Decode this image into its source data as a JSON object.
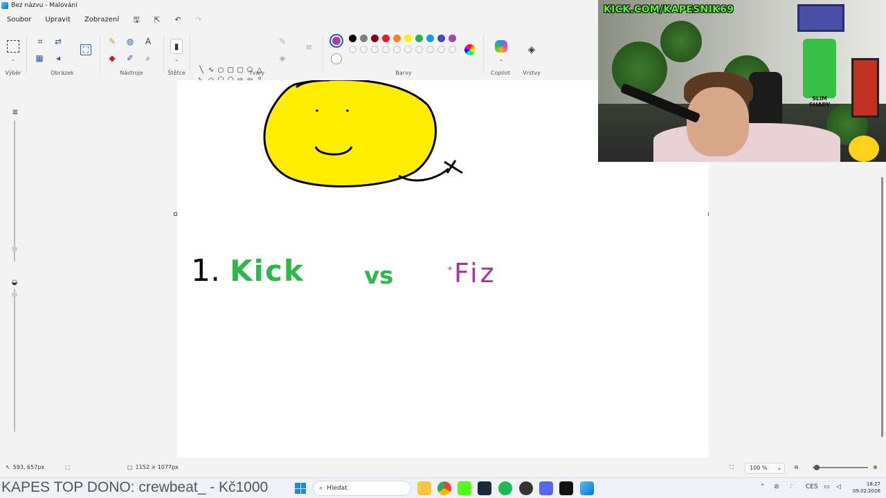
{
  "window": {
    "title": "Bez názvu - Malování"
  },
  "menu": {
    "file": "Soubor",
    "edit": "Upravit",
    "view": "Zobrazení"
  },
  "ribbon": {
    "groups": {
      "selection": "Výběr",
      "image": "Obrázek",
      "tools": "Nástroje",
      "brushes": "Štětce",
      "shapes": "Tvary",
      "colors": "Barvy",
      "copilot": "Copilot",
      "layers": "Vrstvy"
    },
    "current_color": "#a040b0",
    "palette_row1": [
      "#000000",
      "#7f7f7f",
      "#880015",
      "#ed1c24",
      "#ff7f27",
      "#fff200",
      "#22b14c",
      "#00a2e8",
      "#3f48cc",
      "#a349a4"
    ],
    "palette_row2": [
      "#ffffff",
      "#c3c3c3",
      "#b97a57",
      "#ffaec9",
      "#ffc90e",
      "#efe4b0",
      "#b5e61d",
      "#99d9ea",
      "#7092be",
      "#c8bfe7"
    ]
  },
  "canvas_drawing": {
    "line_number": "1.",
    "word_kick": "Kick",
    "word_vs": "vs",
    "word_fiz": "Fiz",
    "colors": {
      "face": "#ffee00",
      "kick": "#2db84b",
      "fiz": "#a3329f",
      "ink": "#000000"
    }
  },
  "webcam": {
    "overlay_text": "KICK.COM/KAPESNIK69",
    "hoodie_text": "SLIM SHADY"
  },
  "status": {
    "cursor_pos": "593, 657px",
    "canvas_size": "1152 × 1077px",
    "zoom": "100 %"
  },
  "taskbar": {
    "ticker": "KAPES TOP DONO: crewbeat_ - Kč1000",
    "search_placeholder": "Hledat",
    "language": "CES",
    "time": "18:27",
    "date": "09.02.2026"
  }
}
